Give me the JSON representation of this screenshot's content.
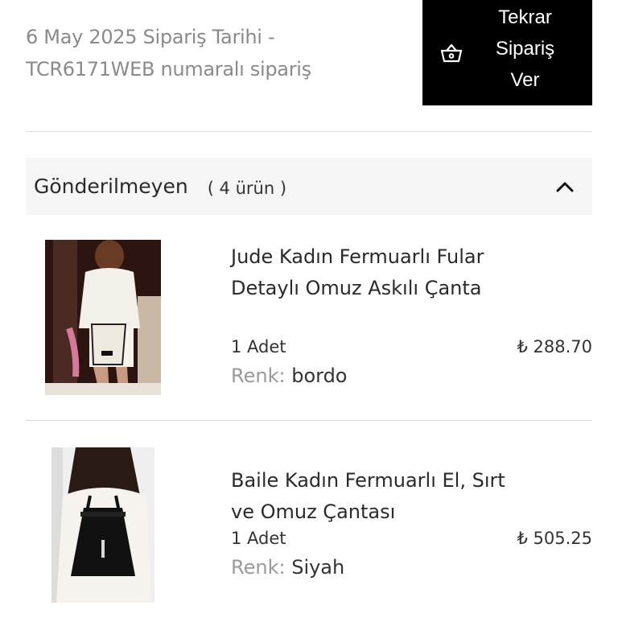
{
  "order": {
    "meta_line1": "6 May 2025 Sipariş Tarihi -",
    "meta_line2": "TCR6171WEB numaralı sipariş",
    "reorder_label": "Tekrar\nSipariş\nVer",
    "reorder_icon": "basket-icon"
  },
  "section": {
    "title": "Gönderilmeyen",
    "count": "( 4 ürün )",
    "toggle_icon": "chevron-up-icon"
  },
  "items": [
    {
      "title": "Jude Kadın Fermuarlı Fular Detaylı Omuz Askılı Çanta",
      "quantity": "1 Adet",
      "color_label": "Renk:",
      "color_value": "bordo",
      "price": "₺ 288.70"
    },
    {
      "title": "Baile Kadın Fermuarlı El, Sırt ve Omuz Çantası",
      "quantity": "1 Adet",
      "color_label": "Renk:",
      "color_value": "Siyah",
      "price": "₺ 505.25"
    }
  ],
  "colors": {
    "button_bg": "#000000",
    "section_bg": "#f5f5f5",
    "muted_text": "#8a8a8a"
  }
}
